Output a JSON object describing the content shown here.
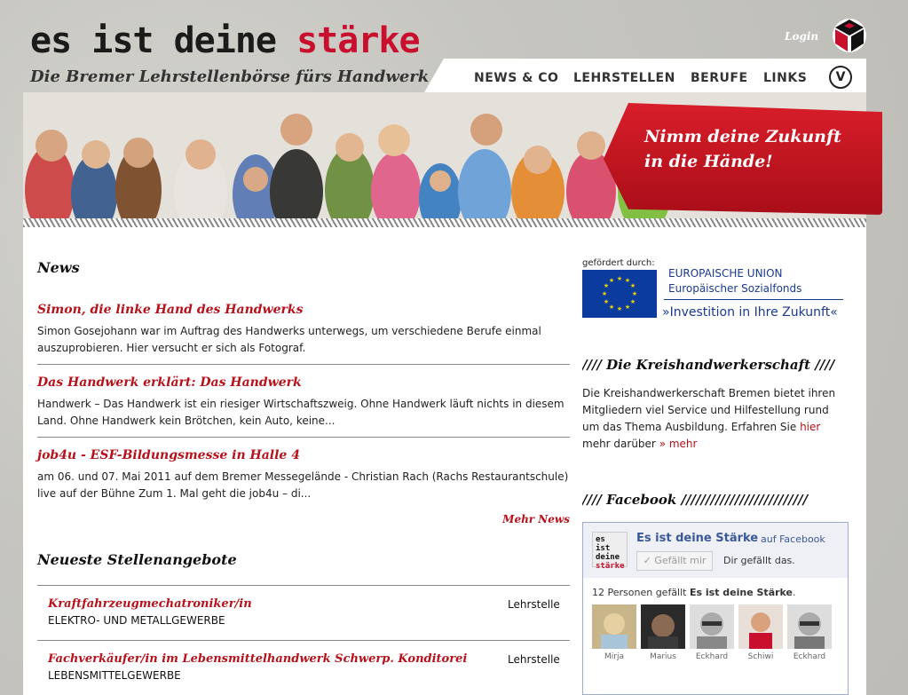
{
  "logo": {
    "part1": "es ist deine ",
    "part2": "stärke"
  },
  "header": {
    "login": "Login",
    "tagline": "Die Bremer Lehrstellenbörse fürs Handwerk"
  },
  "nav": {
    "items": [
      "NEWS & CO",
      "LEHRSTELLEN",
      "BERUFE",
      "LINKS"
    ],
    "icon": "V"
  },
  "hero": {
    "banner_line1": "Nimm deine Zukunft",
    "banner_line2": "in die Hände!"
  },
  "news": {
    "heading": "News",
    "items": [
      {
        "title": "Simon, die linke Hand des Handwerks",
        "body": "Simon Gosejohann war im Auftrag des Handwerks unterwegs, um verschiedene Berufe einmal auszuprobieren. Hier versucht er sich als Fotograf."
      },
      {
        "title": "Das Handwerk erklärt: Das Handwerk",
        "body": "Handwerk – Das Handwerk ist ein riesiger Wirtschaftszweig. Ohne Handwerk läuft nichts in diesem Land. Ohne Handwerk kein Brötchen, kein Auto, keine..."
      },
      {
        "title": "job4u - ESF-Bildungsmesse in Halle 4",
        "body": "am 06. und 07. Mai 2011 auf dem Bremer Messegelände - Christian Rach (Rachs Restaurantschule) live auf der Bühne Zum 1. Mal geht die job4u – di..."
      }
    ],
    "more": "Mehr News"
  },
  "jobs": {
    "heading": "Neueste Stellenangebote",
    "items": [
      {
        "title": "Kraftfahrzeugmechatroniker/in",
        "category": "ELEKTRO- UND METALLGEWERBE",
        "type": "Lehrstelle"
      },
      {
        "title": "Fachverkäufer/in im Lebensmittelhandwerk Schwerp. Konditorei",
        "category": "LEBENSMITTELGEWERBE",
        "type": "Lehrstelle"
      }
    ]
  },
  "eu": {
    "funded_by": "gefördert durch:",
    "line1": "EUROPAISCHE UNION",
    "line2": "Europäischer Sozialfonds",
    "line3": "»Investition in Ihre Zukunft«"
  },
  "kreis": {
    "heading": "//// Die Kreishandwerkerschaft ////",
    "body": "Die Kreishandwerkerschaft Bremen bietet ihren Mitgliedern viel Service und Hilfestellung rund um das Thema Ausbildung. Erfahren Sie ",
    "link_hier": "hier",
    "body2": " mehr darüber ",
    "link_mehr": "» mehr"
  },
  "facebook": {
    "heading": "//// Facebook //////////////////////////",
    "page_name": "Es ist deine Stärke",
    "on": "auf Facebook",
    "like_button": "✓ Gefällt mir",
    "likes_text": "Dir gefällt das.",
    "count_pre": "12 Personen gefällt ",
    "count_name": "Es ist deine Stärke",
    "count_post": ".",
    "logo_l1": "es ist",
    "logo_l2": "deine",
    "logo_l3": "stärke",
    "fans": [
      "Mirja",
      "Marius",
      "Eckhard",
      "Schiwi",
      "Eckhard"
    ]
  },
  "colors": {
    "accent": "#b5121b",
    "fb_blue": "#3b5998"
  }
}
